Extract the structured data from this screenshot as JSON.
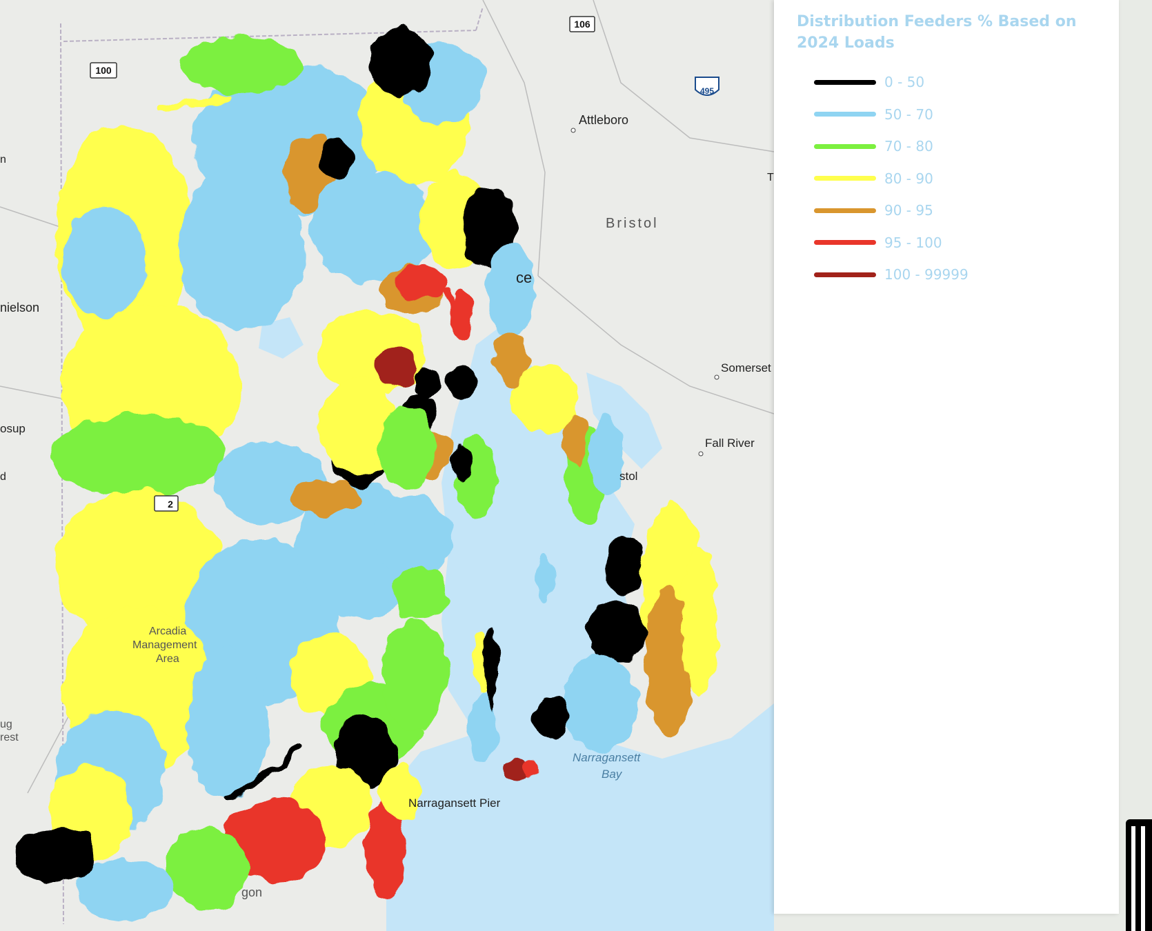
{
  "legend": {
    "title": "Distribution Feeders % Based on 2024 Loads",
    "title_color": "#a9d6ef",
    "label_color": "#a9d6ef",
    "items": [
      {
        "label": "0 - 50",
        "color": "#000000"
      },
      {
        "label": "50 - 70",
        "color": "#8fd4f2"
      },
      {
        "label": "70 - 80",
        "color": "#7cf03f"
      },
      {
        "label": "80 - 90",
        "color": "#ffff4d"
      },
      {
        "label": "90 - 95",
        "color": "#d9962e"
      },
      {
        "label": "95 - 100",
        "color": "#e9362a"
      },
      {
        "label": "100 - 99999",
        "color": "#a1221a"
      }
    ]
  },
  "map": {
    "water_color": "#c4e5f8",
    "land_color": "#ebece9",
    "places": {
      "attleboro": "Attleboro",
      "bristol_county": "Bristol",
      "providence": "ce",
      "somerset": "Somerset",
      "fall_river": "Fall River",
      "danielson": "nielson",
      "bristol_town": "stol",
      "moosup": "osup",
      "arcadia": "Arcadia",
      "arcadia2": "Management",
      "arcadia3": "Area",
      "narragansett_bay_1": "Narragansett",
      "narragansett_bay_2": "Bay",
      "narragansett_pier": "Narragansett Pier",
      "forest_1": "ug",
      "forest_2": "rest",
      "edge_t": "T",
      "edge_d": "d",
      "edge_n": "n",
      "kingston": "gon"
    },
    "shields": {
      "route_106": "106",
      "route_100": "100",
      "interstate_495": "495",
      "route_2": "2"
    }
  }
}
